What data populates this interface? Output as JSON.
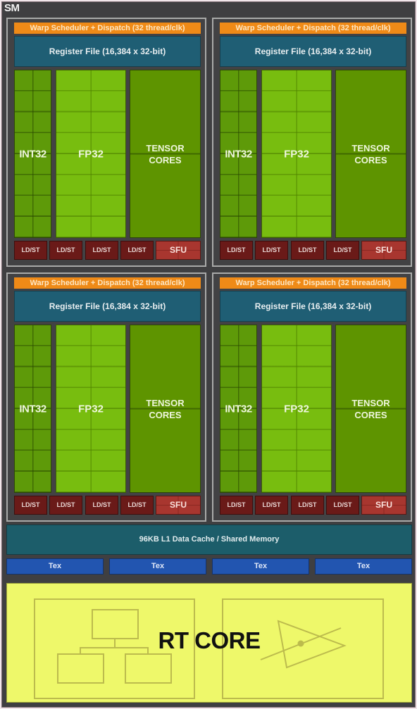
{
  "sm": {
    "title": "SM",
    "partitions": [
      {
        "warp": "Warp Scheduler + Dispatch (32 thread/clk)",
        "register_file": "Register File (16,384 x 32-bit)",
        "int": "INT32",
        "fp": "FP32",
        "tensor_line1": "TENSOR",
        "tensor_line2": "CORES",
        "ldst": [
          "LD/ST",
          "LD/ST",
          "LD/ST",
          "LD/ST"
        ],
        "sfu": "SFU"
      },
      {
        "warp": "Warp Scheduler + Dispatch (32 thread/clk)",
        "register_file": "Register File (16,384 x 32-bit)",
        "int": "INT32",
        "fp": "FP32",
        "tensor_line1": "TENSOR",
        "tensor_line2": "CORES",
        "ldst": [
          "LD/ST",
          "LD/ST",
          "LD/ST",
          "LD/ST"
        ],
        "sfu": "SFU"
      },
      {
        "warp": "Warp Scheduler + Dispatch (32 thread/clk)",
        "register_file": "Register File (16,384 x 32-bit)",
        "int": "INT32",
        "fp": "FP32",
        "tensor_line1": "TENSOR",
        "tensor_line2": "CORES",
        "ldst": [
          "LD/ST",
          "LD/ST",
          "LD/ST",
          "LD/ST"
        ],
        "sfu": "SFU"
      },
      {
        "warp": "Warp Scheduler + Dispatch (32 thread/clk)",
        "register_file": "Register File (16,384 x 32-bit)",
        "int": "INT32",
        "fp": "FP32",
        "tensor_line1": "TENSOR",
        "tensor_line2": "CORES",
        "ldst": [
          "LD/ST",
          "LD/ST",
          "LD/ST",
          "LD/ST"
        ],
        "sfu": "SFU"
      }
    ],
    "l1_cache": "96KB L1 Data Cache / Shared Memory",
    "tex": [
      "Tex",
      "Tex",
      "Tex",
      "Tex"
    ],
    "rt_core": "RT CORE",
    "rt_icons": [
      "bvh-tree-icon",
      "ray-triangle-intersection-icon"
    ]
  },
  "colors": {
    "warp": "#ef8a17",
    "register_file": "#1f5e74",
    "int32": "#5e9a09",
    "fp32": "#78bd0f",
    "tensor": "#5e9400",
    "ldst": "#6a1a18",
    "sfu": "#a8362f",
    "l1": "#1c5d6a",
    "tex": "#2255b0",
    "rt_core": "#eef86a"
  }
}
